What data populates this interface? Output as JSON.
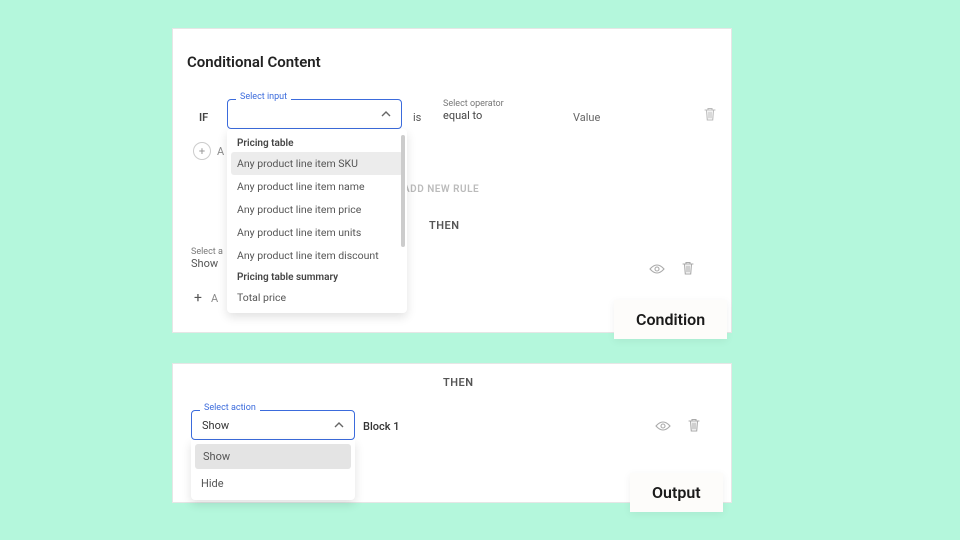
{
  "top": {
    "title": "Conditional Content",
    "if_label": "IF",
    "select_input": {
      "label": "Select input",
      "value": ""
    },
    "is_label": "is",
    "operator": {
      "label": "Select operator",
      "value": "equal to"
    },
    "value_label": "Value",
    "add_hidden": "A",
    "add_new_rule": "ADD NEW RULE",
    "then_label": "THEN",
    "select_action_label": "Select a",
    "select_action_value": "Show",
    "add_text": "A",
    "dropdown": {
      "group1": "Pricing table",
      "items1": [
        "Any product line item SKU",
        "Any product line item name",
        "Any product line item price",
        "Any product line item units",
        "Any product line item discount"
      ],
      "group2": "Pricing table summary",
      "items2": [
        "Total price"
      ]
    }
  },
  "bottom": {
    "then_label": "THEN",
    "select_action": {
      "label": "Select action",
      "value": "Show"
    },
    "block_label": "Block 1",
    "dropdown": {
      "items": [
        "Show",
        "Hide"
      ]
    }
  },
  "tags": {
    "condition": "Condition",
    "output": "Output"
  }
}
